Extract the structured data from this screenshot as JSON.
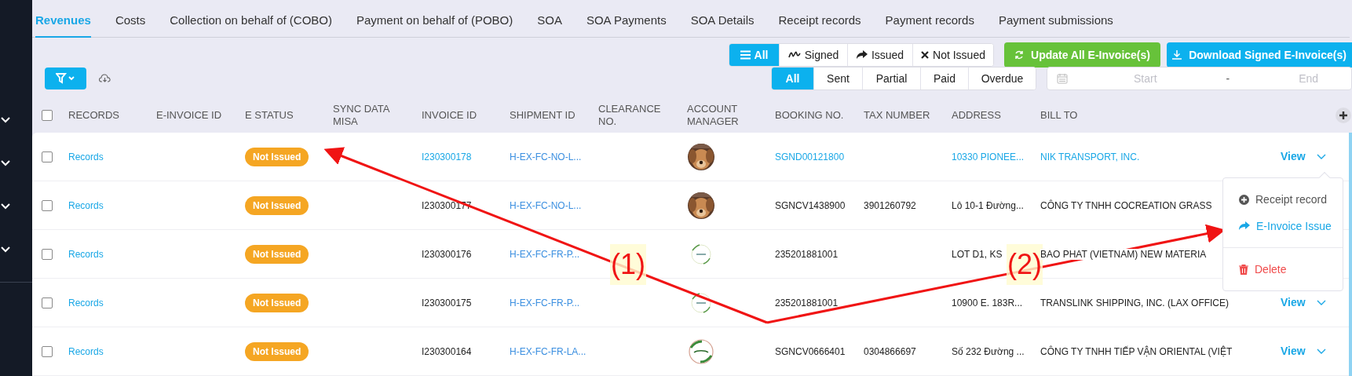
{
  "tabs": [
    {
      "label": "Revenues",
      "selected": true
    },
    {
      "label": "Costs",
      "selected": false
    },
    {
      "label": "Collection on behalf of (COBO)",
      "selected": false
    },
    {
      "label": "Payment on behalf of (POBO)",
      "selected": false
    },
    {
      "label": "SOA",
      "selected": false
    },
    {
      "label": "SOA Payments",
      "selected": false
    },
    {
      "label": "SOA Details",
      "selected": false
    },
    {
      "label": "Receipt records",
      "selected": false
    },
    {
      "label": "Payment records",
      "selected": false
    },
    {
      "label": "Payment submissions",
      "selected": false
    }
  ],
  "e_invoice_filter": [
    {
      "label": "All",
      "selected": true
    },
    {
      "label": "Signed",
      "selected": false
    },
    {
      "label": "Issued",
      "selected": false
    },
    {
      "label": "Not Issued",
      "selected": false
    }
  ],
  "action_buttons": [
    "Update All E-Invoice(s)",
    "Download Signed E-Invoice(s)"
  ],
  "status_filter": [
    {
      "label": "All",
      "selected": true
    },
    {
      "label": "Sent",
      "selected": false
    },
    {
      "label": "Partial",
      "selected": false
    },
    {
      "label": "Paid",
      "selected": false
    },
    {
      "label": "Overdue",
      "selected": false
    }
  ],
  "date_range": {
    "start_placeholder": "Start",
    "separator": "-",
    "end_placeholder": "End"
  },
  "table": {
    "header_checked": false,
    "columns": [
      "RECORDS",
      "E-INVOICE ID",
      "E STATUS",
      "SYNC DATA MISA",
      "INVOICE ID",
      "SHIPMENT ID",
      "CLEARANCE NO.",
      "ACCOUNT MANAGER",
      "BOOKING NO.",
      "TAX NUMBER",
      "ADDRESS",
      "BILL TO"
    ],
    "rows": [
      {
        "checked": false,
        "highlighted": true,
        "records": "Records",
        "e_status": "Not Issued",
        "invoice_id": "I230300178",
        "shipment_id": "H-EX-FC-NO-L...",
        "booking_no": "SGND00121800",
        "address": "10330 PIONEE...",
        "bill_to": "NIK TRANSPORT, INC.",
        "view": "View",
        "menu_open": true
      },
      {
        "checked": false,
        "highlighted": false,
        "records": "Records",
        "e_status": "Not Issued",
        "invoice_id": "I230300177",
        "shipment_id": "H-EX-FC-NO-L...",
        "booking_no": "SGNCV1438900",
        "tax_number": "3901260792",
        "address": "Lô 10-1 Đường...",
        "bill_to": "CÔNG TY TNHH COCREATION GRASS"
      },
      {
        "checked": false,
        "highlighted": false,
        "records": "Records",
        "e_status": "Not Issued",
        "invoice_id": "I230300176",
        "shipment_id": "H-EX-FC-FR-P...",
        "booking_no": "235201881001",
        "address": "LOT D1, KS",
        "bill_to": "BAO PHAT (VIETNAM) NEW MATERIA"
      },
      {
        "checked": false,
        "highlighted": false,
        "records": "Records",
        "e_status": "Not Issued",
        "invoice_id": "I230300175",
        "shipment_id": "H-EX-FC-FR-P...",
        "booking_no": "235201881001",
        "address": "10900 E. 183R...",
        "bill_to": "TRANSLINK SHIPPING, INC. (LAX OFFICE)",
        "view": "View"
      },
      {
        "checked": false,
        "highlighted": false,
        "records": "Records",
        "e_status": "Not Issued",
        "invoice_id": "I230300164",
        "shipment_id": "H-EX-FC-FR-LA...",
        "booking_no": "SGNCV0666401",
        "tax_number": "0304866697",
        "address": "Số 232 Đường ...",
        "bill_to": "CÔNG TY TNHH TIẾP VẬN ORIENTAL (VIỆT",
        "view": "View"
      }
    ]
  },
  "context_menu": [
    {
      "label": "Receipt record",
      "kind": "add"
    },
    {
      "label": "E-Invoice Issue",
      "kind": "issue"
    },
    {
      "label": "Delete",
      "kind": "delete"
    }
  ],
  "annotations": [
    {
      "label": "(1)"
    },
    {
      "label": "(2)"
    }
  ]
}
